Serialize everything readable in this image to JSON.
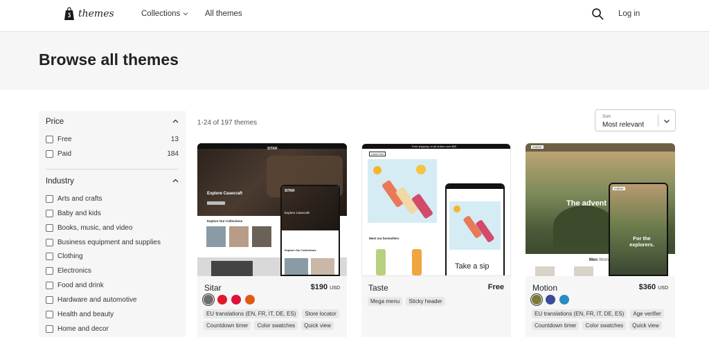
{
  "header": {
    "logo_text": "themes",
    "nav": [
      {
        "label": "Collections"
      },
      {
        "label": "All themes"
      }
    ],
    "login_label": "Log in"
  },
  "hero": {
    "title": "Browse all themes"
  },
  "filters": {
    "price": {
      "title": "Price",
      "options": [
        {
          "label": "Free",
          "count": "13"
        },
        {
          "label": "Paid",
          "count": "184"
        }
      ]
    },
    "industry": {
      "title": "Industry",
      "options": [
        {
          "label": "Arts and crafts"
        },
        {
          "label": "Baby and kids"
        },
        {
          "label": "Books, music, and video"
        },
        {
          "label": "Business equipment and supplies"
        },
        {
          "label": "Clothing"
        },
        {
          "label": "Electronics"
        },
        {
          "label": "Food and drink"
        },
        {
          "label": "Hardware and automotive"
        },
        {
          "label": "Health and beauty"
        },
        {
          "label": "Home and decor"
        }
      ]
    }
  },
  "results": {
    "count_text": "1-24 of 197 themes",
    "sort": {
      "small_label": "Sort",
      "value": "Most relevant"
    }
  },
  "themes": [
    {
      "name": "Sitar",
      "price": "$190",
      "currency": "USD",
      "swatches": [
        "#6e6e6e",
        "#e0182c",
        "#e0103a",
        "#e25a12"
      ],
      "tags": [
        "EU translations (EN, FR, IT, DE, ES)",
        "Store locator",
        "Countdown timer",
        "Color swatches",
        "Quick view"
      ],
      "preview": {
        "brand": "SITAR",
        "hero_heading": "Explore Casecraft",
        "section_heading": "Explore Our Collections",
        "mobile_heading": "Explore Casecraft",
        "mobile_section": "Explore Our Collections"
      }
    },
    {
      "name": "Taste",
      "price": "Free",
      "currency": "",
      "swatches": [],
      "tags": [
        "Mega menu",
        "Sticky header"
      ],
      "preview": {
        "announcement": "Free shipping on all orders over $50",
        "brand": "Label One",
        "hero_heading": "Take a sip",
        "section_heading": "Meet our bestsellers"
      }
    },
    {
      "name": "Motion",
      "price": "$360",
      "currency": "USD",
      "swatches": [
        "#7c7a34",
        "#3a4a9a",
        "#2a8cc0"
      ],
      "tags": [
        "EU translations (EN, FR, IT, DE, ES)",
        "Age verifier",
        "Countdown timer",
        "Color swatches",
        "Quick view"
      ],
      "preview": {
        "brand": "motion",
        "hero_heading": "The advent",
        "mobile_heading": "For the explorers.",
        "tab_men": "Men",
        "tab_women": "Wome"
      }
    }
  ]
}
